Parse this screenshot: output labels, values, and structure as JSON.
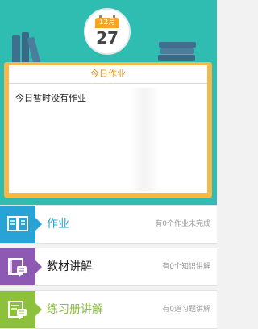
{
  "calendar": {
    "month": "12月",
    "day": "27"
  },
  "homework_card": {
    "title": "今日作业",
    "empty_message": "今日暂时没有作业"
  },
  "menu": [
    {
      "label": "作业",
      "status": "有0个作业未完成",
      "icon": "open-book-icon",
      "color": "#27a3d6"
    },
    {
      "label": "教材讲解",
      "status": "有0个知识讲解",
      "icon": "textbook-chat-icon",
      "color": "#8e59b3"
    },
    {
      "label": "练习册讲解",
      "status": "有0道习题讲解",
      "icon": "workbook-chat-icon",
      "color": "#8cc03d"
    }
  ],
  "colors": {
    "header_background": "#2fbdb2",
    "book_cover": "#f6b84b",
    "card_title": "#e0911a"
  }
}
